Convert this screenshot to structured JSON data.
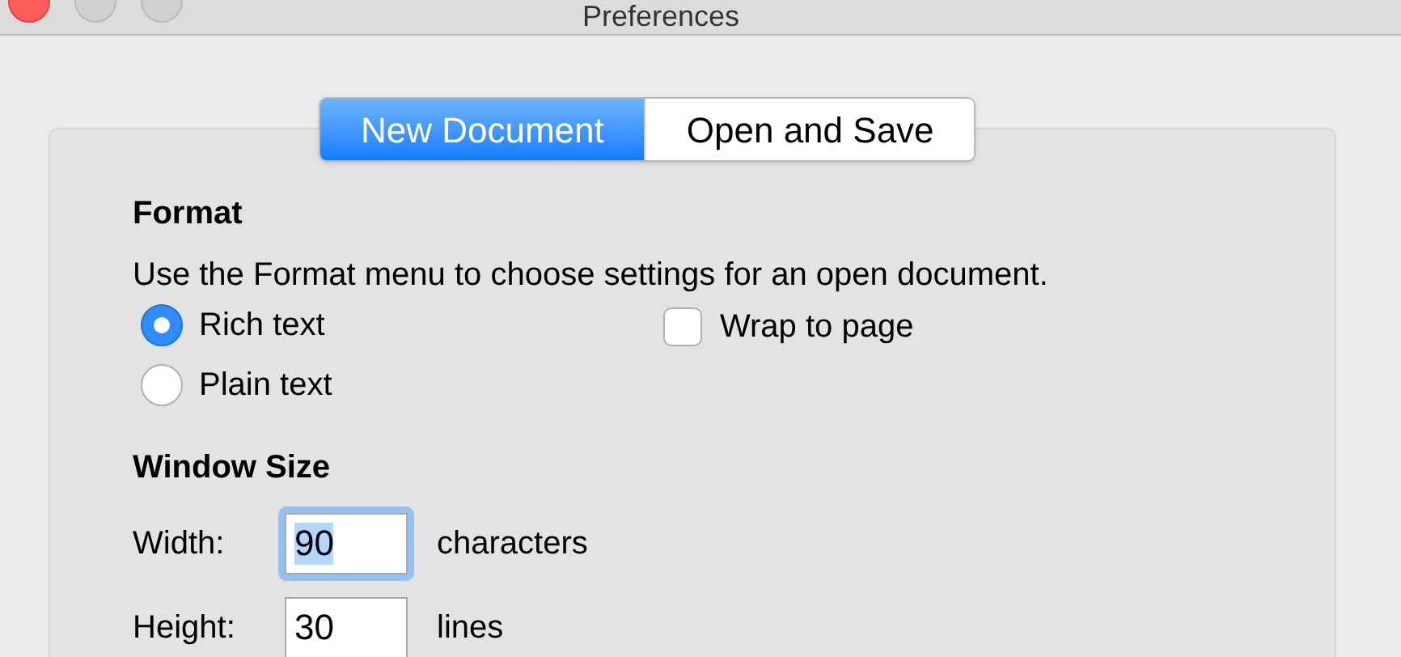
{
  "window": {
    "title": "Preferences"
  },
  "tabs": [
    {
      "label": "New Document",
      "selected": true
    },
    {
      "label": "Open and Save",
      "selected": false
    }
  ],
  "format": {
    "heading": "Format",
    "description": "Use the Format menu to choose settings for an open document.",
    "radios": [
      {
        "label": "Rich text",
        "selected": true
      },
      {
        "label": "Plain text",
        "selected": false
      }
    ],
    "wrap_to_page": {
      "label": "Wrap to page",
      "checked": false
    }
  },
  "window_size": {
    "heading": "Window Size",
    "fields": [
      {
        "label": "Width:",
        "value": "90",
        "unit": "characters",
        "focused": true
      },
      {
        "label": "Height:",
        "value": "30",
        "unit": "lines",
        "focused": false
      }
    ]
  }
}
